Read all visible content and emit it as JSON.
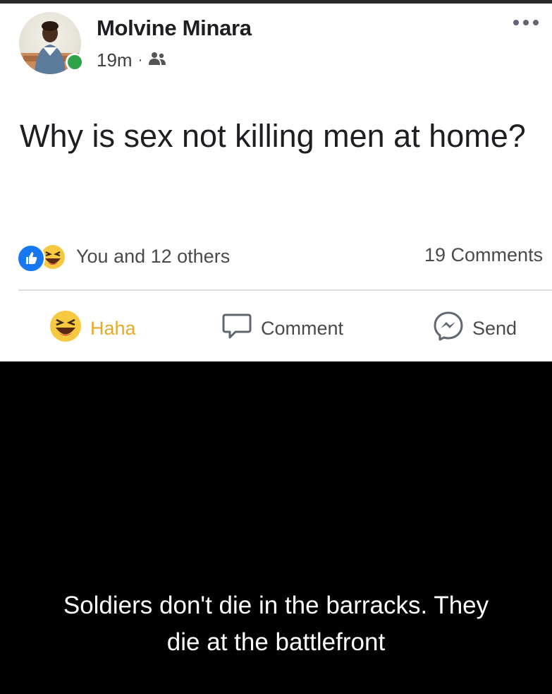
{
  "post": {
    "author_name": "Molvine Minara",
    "timestamp": "19m",
    "separator": "·",
    "audience_icon": "friends-icon",
    "more_icon": "more-options-icon",
    "text": "Why is sex not killing men at home?",
    "reactions_summary": "You and 12 others",
    "reaction_icons": [
      "like-icon",
      "haha-icon"
    ],
    "comments_count": "19 Comments",
    "online": true
  },
  "actions": {
    "haha_label": "Haha",
    "comment_label": "Comment",
    "send_label": "Send"
  },
  "colors": {
    "like_blue": "#1877f2",
    "haha_yellow": "#f7c940",
    "haha_label": "#e9a928",
    "online_green": "#31a24c",
    "caption_bg": "#000000",
    "caption_text": "#ffffff"
  },
  "caption": {
    "line1": "Soldiers don't die in the barracks. They",
    "line2": "die at the battlefront"
  }
}
